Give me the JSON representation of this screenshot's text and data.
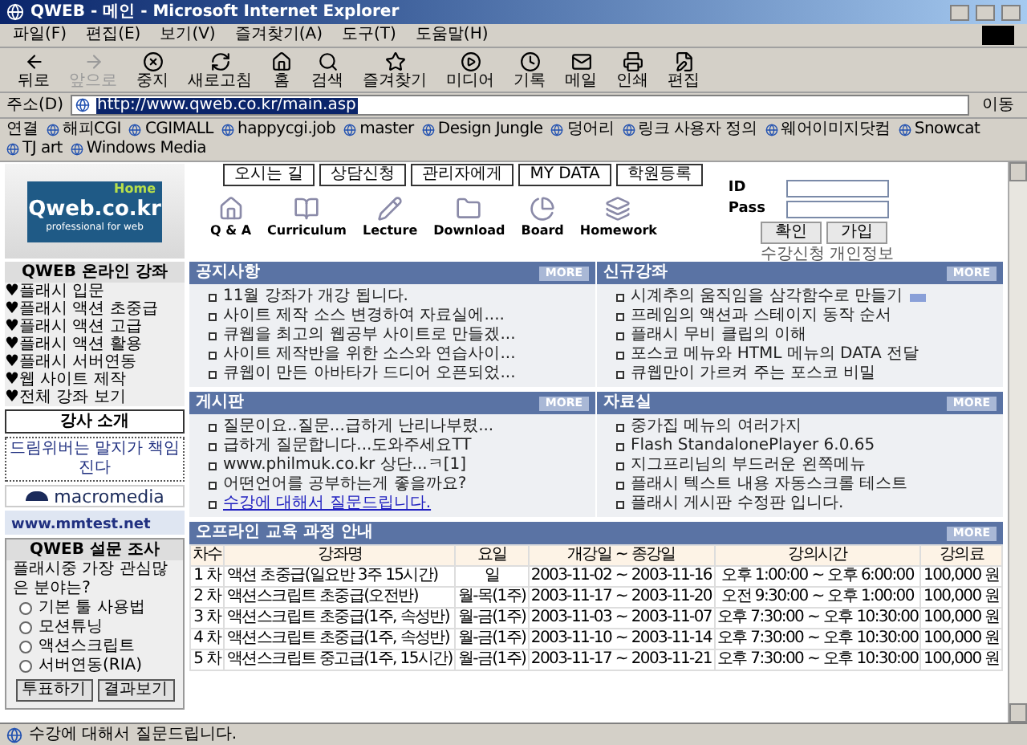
{
  "window": {
    "title": "QWEB - 메인 - Microsoft Internet Explorer"
  },
  "menu": [
    "파일(F)",
    "편집(E)",
    "보기(V)",
    "즐겨찾기(A)",
    "도구(T)",
    "도움말(H)"
  ],
  "toolbar": [
    {
      "label": "뒤로",
      "disabled": false
    },
    {
      "label": "앞으로",
      "disabled": true
    },
    {
      "label": "중지",
      "disabled": false
    },
    {
      "label": "새로고침",
      "disabled": false
    },
    {
      "label": "홈",
      "disabled": false
    },
    {
      "label": "검색",
      "disabled": false
    },
    {
      "label": "즐겨찾기",
      "disabled": false
    },
    {
      "label": "미디어",
      "disabled": false
    },
    {
      "label": "기록",
      "disabled": false
    },
    {
      "label": "메일",
      "disabled": false
    },
    {
      "label": "인쇄",
      "disabled": false
    },
    {
      "label": "편집",
      "disabled": false
    }
  ],
  "address": {
    "label": "주소(D)",
    "value": "http://www.qweb.co.kr/main.asp",
    "go": "이동"
  },
  "links": {
    "label": "연결",
    "items": [
      "해피CGI",
      "CGIMALL",
      "happycgi.job",
      "master",
      "Design Jungle",
      "덩어리",
      "링크 사용자 정의",
      "웨어이미지닷컴",
      "Snowcat",
      "TJ art",
      "Windows Media"
    ]
  },
  "header": {
    "logo": {
      "name": "Qweb.co.kr",
      "home": "Home",
      "tagline": "professional for web"
    },
    "top_buttons": [
      "오시는 길",
      "상담신청",
      "관리자에게",
      "MY DATA",
      "학원등록"
    ],
    "nav": [
      "Q & A",
      "Curriculum",
      "Lecture",
      "Download",
      "Board",
      "Homework"
    ],
    "login": {
      "id_label": "ID",
      "pass_label": "Pass",
      "buttons": [
        "확인",
        "가입"
      ],
      "links": [
        "수강신청",
        "개인정보"
      ]
    }
  },
  "sidebar": {
    "courses_title": "QWEB 온라인 강좌",
    "courses": [
      "♥플래시 입문",
      "♥플래시 액션 초중급",
      "♥플래시 액션 고급",
      "♥플래시 액션 활용",
      "♥플래시 서버연동",
      "♥웹 사이트 제작",
      "♥전체 강좌 보기"
    ],
    "instructor": "강사 소개",
    "banner": "드림위버는 말지가 책임진다",
    "macromedia": "macromedia",
    "mmtest": "www.mmtest.net",
    "survey": {
      "title": "QWEB 설문 조사",
      "question": "플래시중 가장 관심많은 분야는?",
      "options": [
        {
          "label": "기본 툴 사용법",
          "selected": false
        },
        {
          "label": "모션튜닝",
          "selected": false
        },
        {
          "label": "액션스크립트",
          "selected": false
        },
        {
          "label": "서버연동(RIA)",
          "selected": false
        }
      ],
      "buttons": [
        "투표하기",
        "결과보기"
      ]
    }
  },
  "boards": [
    {
      "title": "공지사항",
      "more": "MORE",
      "items": [
        {
          "text": "11월 강좌가 개강 됩니다.",
          "new": false,
          "link": false
        },
        {
          "text": "사이트 제작 소스 변경하여 자료실에....",
          "new": false,
          "link": false
        },
        {
          "text": "큐웹을 최고의 웹공부 사이트로 만들겠...",
          "new": false,
          "link": false
        },
        {
          "text": "사이트 제작반을 위한 소스와 연습사이...",
          "new": false,
          "link": false
        },
        {
          "text": "큐웹이 만든 아바타가 드디어 오픈되었...",
          "new": false,
          "link": false
        }
      ]
    },
    {
      "title": "신규강좌",
      "more": "MORE",
      "items": [
        {
          "text": "시계추의 움직임을 삼각함수로 만들기",
          "new": true,
          "link": false
        },
        {
          "text": "프레임의 액션과 스테이지 동작 순서",
          "new": false,
          "link": false
        },
        {
          "text": "플래시 무비 클립의 이해",
          "new": false,
          "link": false
        },
        {
          "text": "포스코 메뉴와 HTML 메뉴의 DATA 전달",
          "new": false,
          "link": false
        },
        {
          "text": "큐웹만이 가르켜 주는 포스코 비밀",
          "new": false,
          "link": false
        }
      ]
    },
    {
      "title": "게시판",
      "more": "MORE",
      "items": [
        {
          "text": "질문이요..질문...급하게 난리나부렸...",
          "new": false,
          "link": false
        },
        {
          "text": "급하게 질문합니다...도와주세요TT",
          "new": false,
          "link": false
        },
        {
          "text": "www.philmuk.co.kr 상단...ㅋ[1]",
          "new": false,
          "link": false
        },
        {
          "text": "어떤언어를 공부하는게 좋을까요?",
          "new": false,
          "link": false
        },
        {
          "text": "수강에 대해서 질문드립니다.",
          "new": false,
          "link": true
        }
      ]
    },
    {
      "title": "자료실",
      "more": "MORE",
      "items": [
        {
          "text": "중가집 메뉴의 여러가지",
          "new": false,
          "link": false
        },
        {
          "text": "Flash StandalonePlayer 6.0.65",
          "new": false,
          "link": false
        },
        {
          "text": "지그프리님의 부드러운 왼쪽메뉴",
          "new": false,
          "link": false
        },
        {
          "text": "플래시 텍스트 내용 자동스크롤 테스트",
          "new": false,
          "link": false
        },
        {
          "text": "플래시 게시판 수정판 입니다.",
          "new": false,
          "link": false
        }
      ]
    }
  ],
  "courses_table": {
    "title": "오프라인 교육 과정 안내",
    "more": "MORE",
    "columns": [
      "차수",
      "강좌명",
      "요일",
      "개강일 ~ 종강일",
      "강의시간",
      "강의료"
    ],
    "rows": [
      [
        "1 차",
        "액션 초중급(일요반 3주 15시간)",
        "일",
        "2003-11-02 ~ 2003-11-16",
        "오후 1:00:00 ~ 오후 6:00:00",
        "100,000 원"
      ],
      [
        "2 차",
        "액션스크립트 초중급(오전반)",
        "월-목(1주)",
        "2003-11-17 ~ 2003-11-20",
        "오전 9:30:00 ~ 오후 1:00:00",
        "100,000 원"
      ],
      [
        "3 차",
        "액션스크립트 초중급(1주, 속성반)",
        "월-금(1주)",
        "2003-11-03 ~ 2003-11-07",
        "오후 7:30:00 ~ 오후 10:30:00",
        "100,000 원"
      ],
      [
        "4 차",
        "액션스크립트 초중급(1주, 속성반)",
        "월-금(1주)",
        "2003-11-10 ~ 2003-11-14",
        "오후 7:30:00 ~ 오후 10:30:00",
        "100,000 원"
      ],
      [
        "5 차",
        "액션스크립트 중고급(1주, 15시간)",
        "월-금(1주)",
        "2003-11-17 ~ 2003-11-21",
        "오후 7:30:00 ~ 오후 10:30:00",
        "100,000 원"
      ]
    ]
  },
  "status_bar": {
    "text": "수강에 대해서 질문드립니다."
  }
}
